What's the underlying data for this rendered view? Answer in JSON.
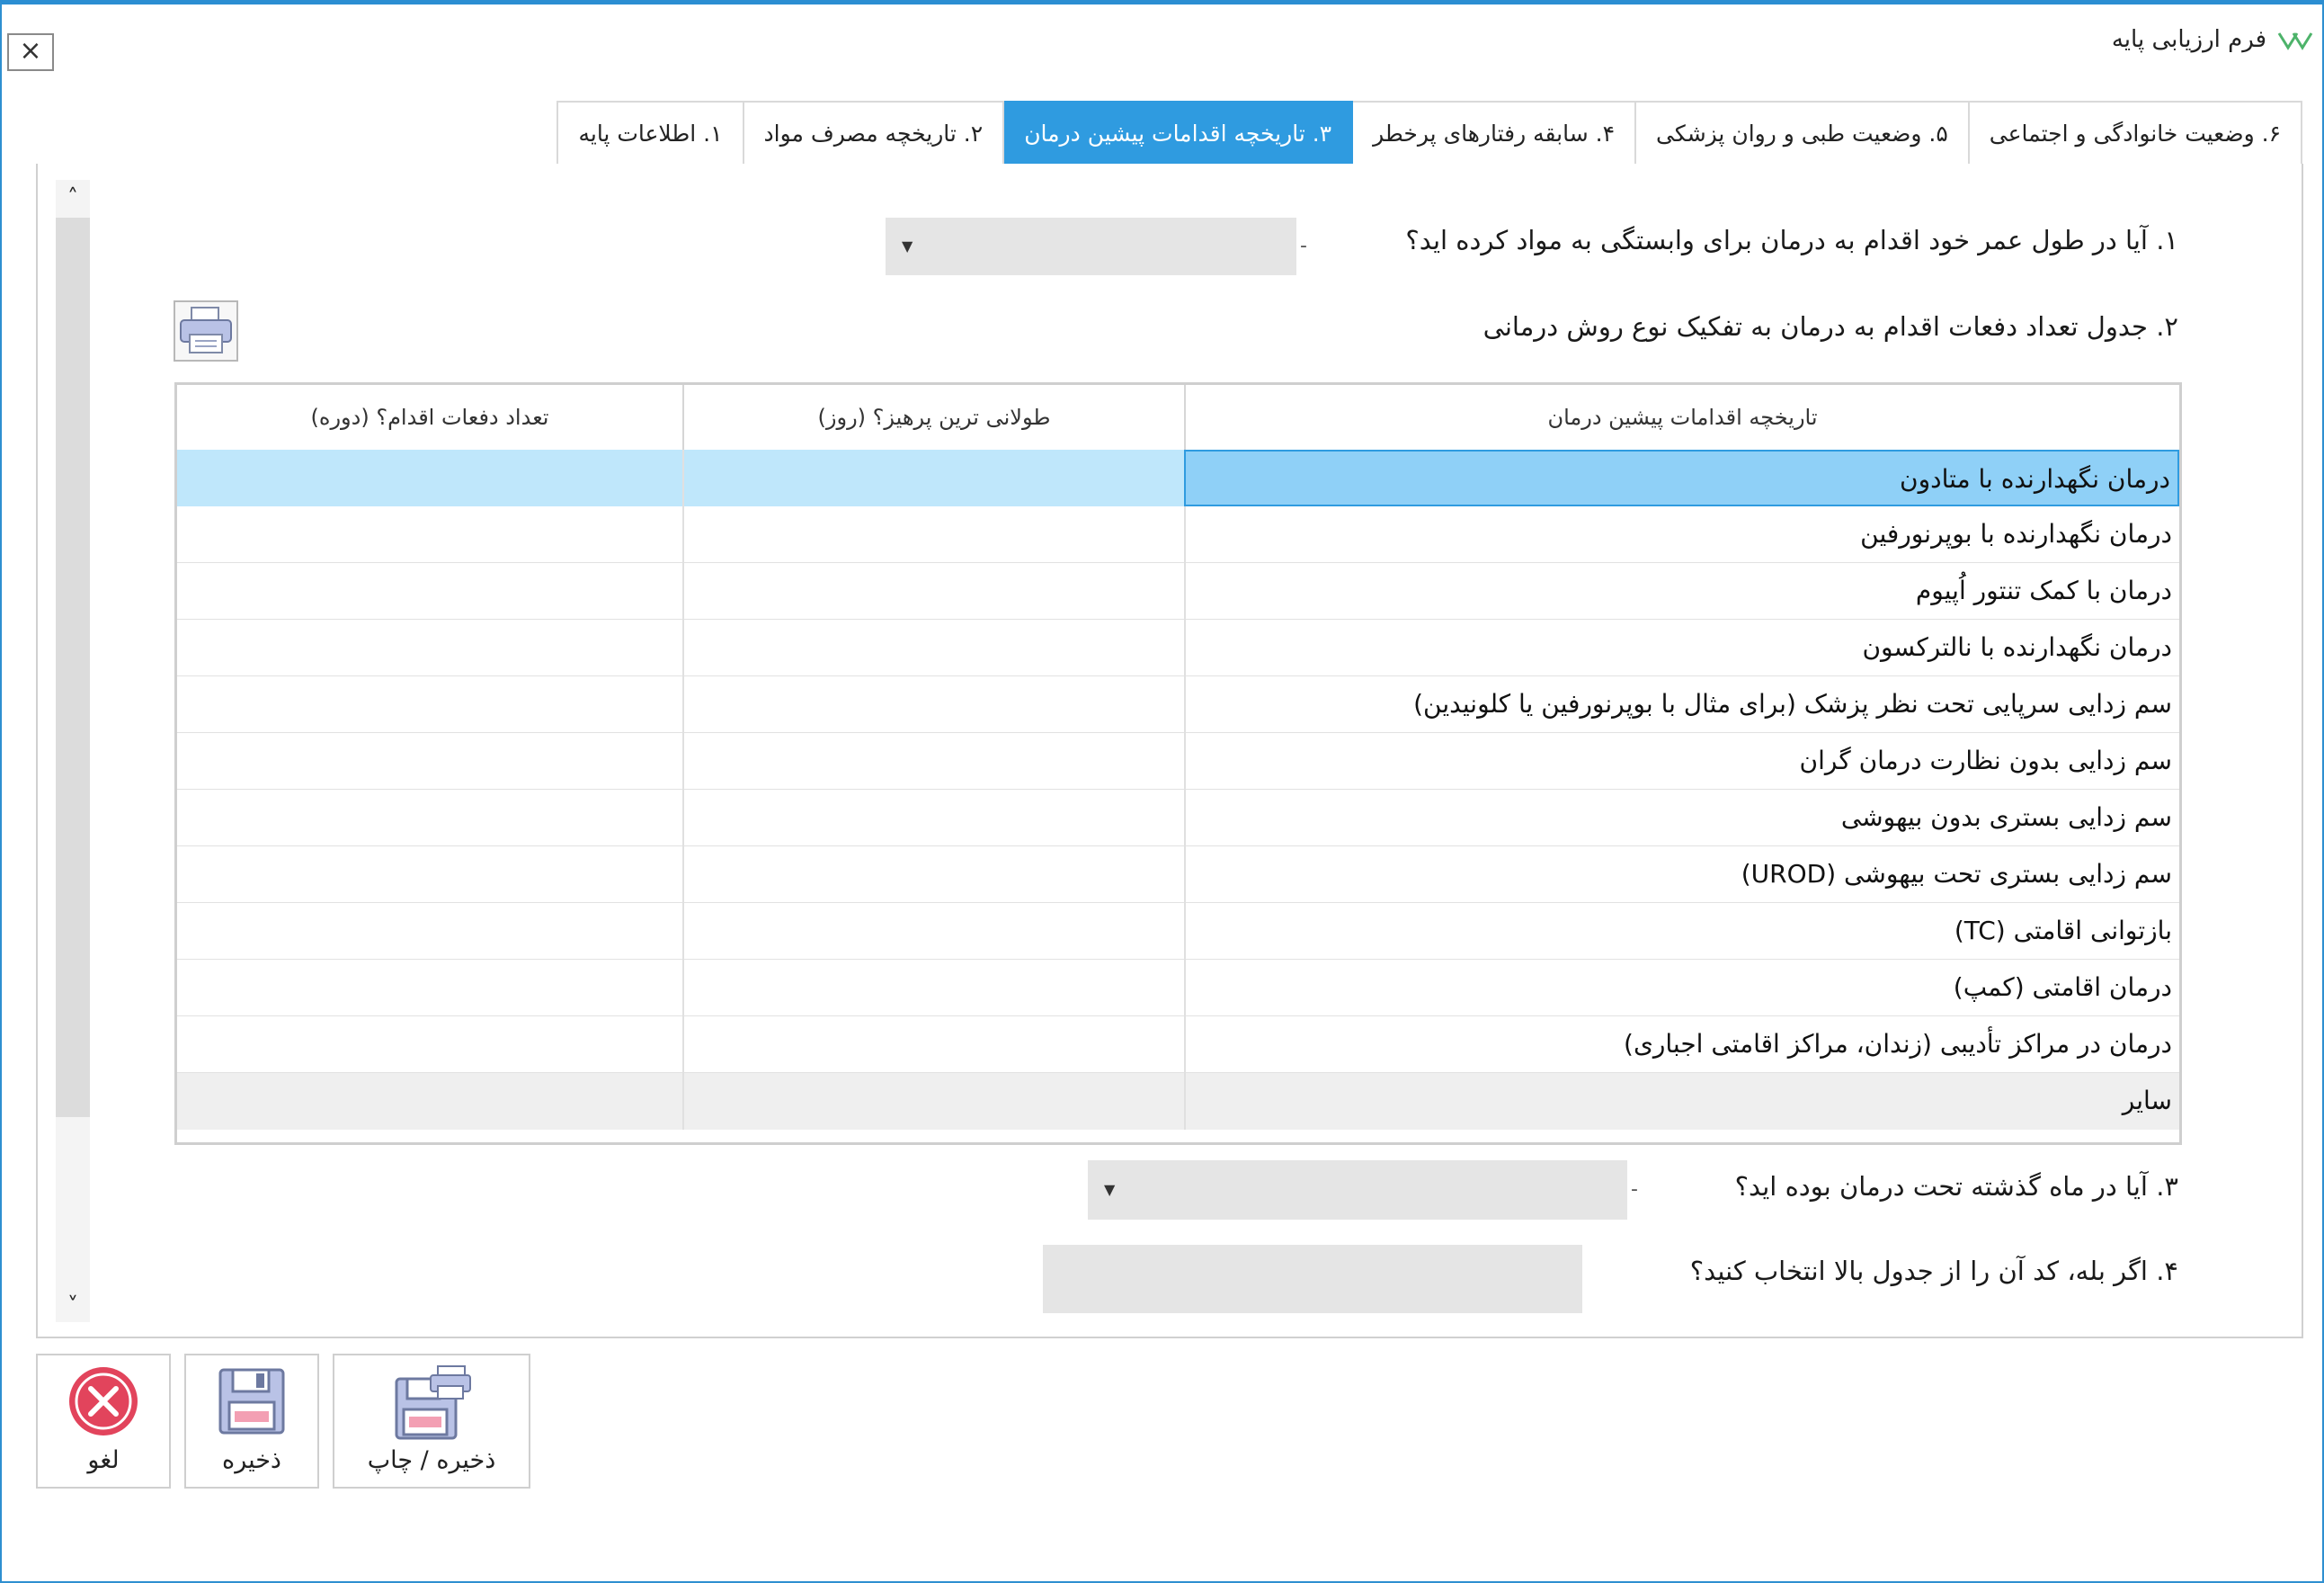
{
  "window": {
    "title": "فرم ارزیابی پایه",
    "close_glyph": "×"
  },
  "tabs": [
    {
      "label": "۱. اطلاعات پایه",
      "active": false
    },
    {
      "label": "۲. تاریخچه مصرف مواد",
      "active": false
    },
    {
      "label": "۳. تاریخچه اقدامات پیشین درمان",
      "active": true
    },
    {
      "label": "۴. سابقه رفتارهای پرخطر",
      "active": false
    },
    {
      "label": "۵. وضعیت طبی و روان پزشکی",
      "active": false
    },
    {
      "label": "۶. وضعیت خانوادگی و اجتماعی",
      "active": false
    }
  ],
  "questions": {
    "q1": "۱. آیا در طول عمر خود اقدام به درمان برای وابستگی به مواد کرده اید؟",
    "q2": "۲. جدول تعداد دفعات اقدام به درمان به تفکیک نوع روش درمانی",
    "q3": "۳. آیا در ماه گذشته تحت درمان بوده اید؟",
    "q4": "۴. اگر بله، کد آن را از جدول بالا انتخاب کنید؟"
  },
  "table": {
    "headers": [
      "تاریخچه اقدامات پیشین درمان",
      "طولانی ترین پرهیز؟ (روز)",
      "تعداد دفعات اقدام؟ (دوره)"
    ],
    "rows": [
      "درمان نگهدارنده با متادون",
      "درمان نگهدارنده با بوپرنورفین",
      "درمان با کمک تنتور اُپیوم",
      "درمان نگهدارنده با نالترکسون",
      "سم زدایی سرپایی تحت نظر پزشک (برای مثال با بوپرنورفین یا کلونیدین)",
      "سم زدایی بدون نظارت درمان گران",
      "سم زدایی بستری بدون بیهوشی",
      "سم زدایی بستری تحت بیهوشی (UROD)",
      "بازتوانی اقامتی (TC)",
      "درمان اقامتی (کمپ)",
      "درمان در مراکز تأدیبی (زندان، مراکز اقامتی اجباری)",
      "سایر"
    ],
    "selected_row": 0
  },
  "buttons": {
    "cancel": "لغو",
    "save": "ذخیره",
    "save_print": "ذخیره / چاپ"
  },
  "colors": {
    "accent": "#2f9be0",
    "selected_row": "#bfe7fb",
    "selected_cell": "#8fd0f7",
    "cancel_icon": "#e2445c"
  }
}
